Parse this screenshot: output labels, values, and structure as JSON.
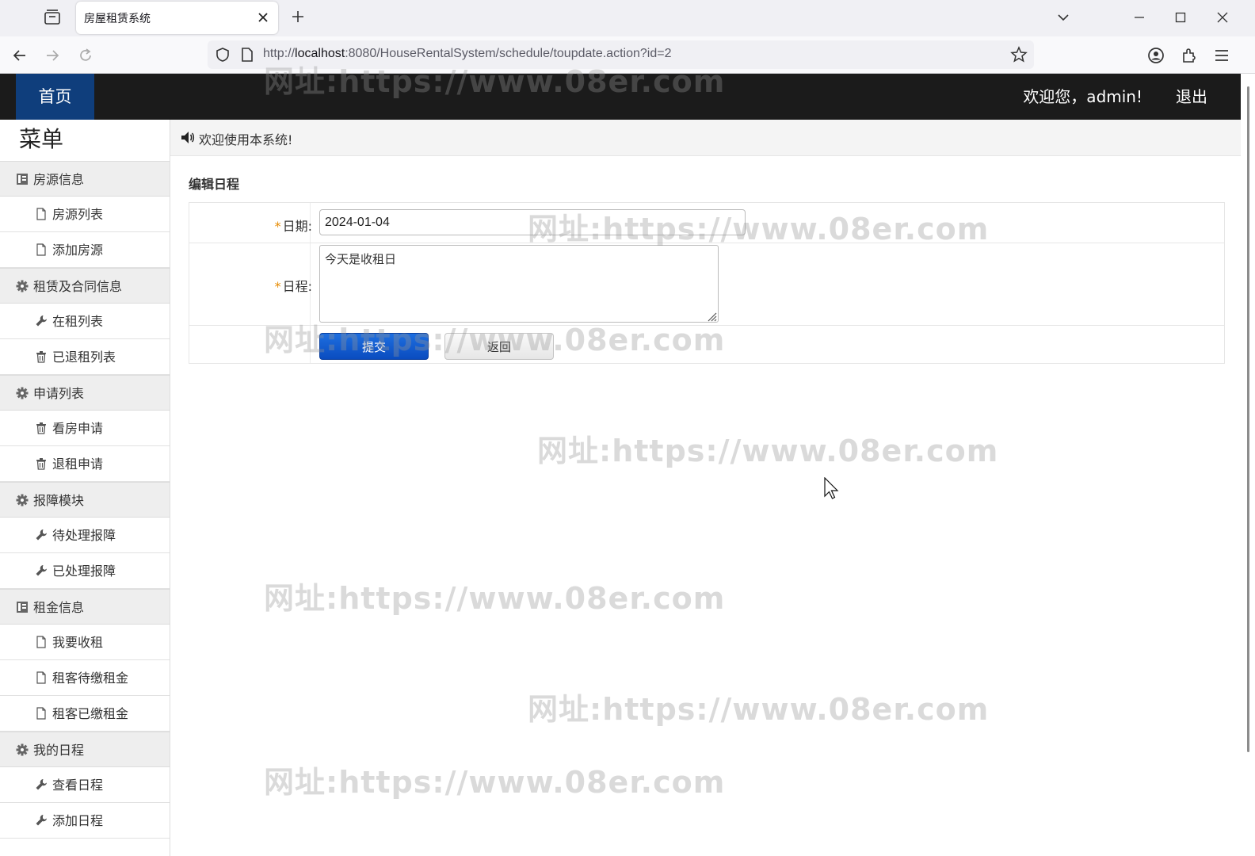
{
  "browser": {
    "tab_title": "房屋租赁系统",
    "url_prefix": "http://",
    "url_host": "localhost",
    "url_rest": ":8080/HouseRentalSystem/schedule/toupdate.action?id=2"
  },
  "header": {
    "home": "首页",
    "welcome": "欢迎您，admin!",
    "logout": "退出"
  },
  "sidebar": {
    "title": "菜单",
    "groups": [
      {
        "label": "房源信息",
        "icon": "list-icon",
        "items": [
          {
            "label": "房源列表",
            "icon": "file-icon"
          },
          {
            "label": "添加房源",
            "icon": "file-icon"
          }
        ]
      },
      {
        "label": "租赁及合同信息",
        "icon": "gear-icon",
        "items": [
          {
            "label": "在租列表",
            "icon": "wrench-icon"
          },
          {
            "label": "已退租列表",
            "icon": "trash-icon"
          }
        ]
      },
      {
        "label": "申请列表",
        "icon": "gear-icon",
        "items": [
          {
            "label": "看房申请",
            "icon": "trash-icon"
          },
          {
            "label": "退租申请",
            "icon": "trash-icon"
          }
        ]
      },
      {
        "label": "报障模块",
        "icon": "gear-icon",
        "items": [
          {
            "label": "待处理报障",
            "icon": "wrench-icon"
          },
          {
            "label": "已处理报障",
            "icon": "wrench-icon"
          }
        ]
      },
      {
        "label": "租金信息",
        "icon": "list-icon",
        "items": [
          {
            "label": "我要收租",
            "icon": "file-icon"
          },
          {
            "label": "租客待缴租金",
            "icon": "file-icon"
          },
          {
            "label": "租客已缴租金",
            "icon": "file-icon"
          }
        ]
      },
      {
        "label": "我的日程",
        "icon": "gear-icon",
        "items": [
          {
            "label": "查看日程",
            "icon": "wrench-icon"
          },
          {
            "label": "添加日程",
            "icon": "wrench-icon"
          }
        ]
      }
    ]
  },
  "main": {
    "notice": "欢迎使用本系统!",
    "section_title": "编辑日程",
    "form": {
      "required_mark": "*",
      "date_label": "日期:",
      "date_value": "2024-01-04",
      "schedule_label": "日程:",
      "schedule_value": "今天是收租日",
      "submit": "提交",
      "back": "返回"
    }
  },
  "watermark": "网址:https://www.08er.com",
  "colors": {
    "header_bg": "#1b1b1b",
    "home_bg": "#0f3e7c",
    "submit_bg": "#0a4cc0",
    "required": "#e68a00"
  }
}
